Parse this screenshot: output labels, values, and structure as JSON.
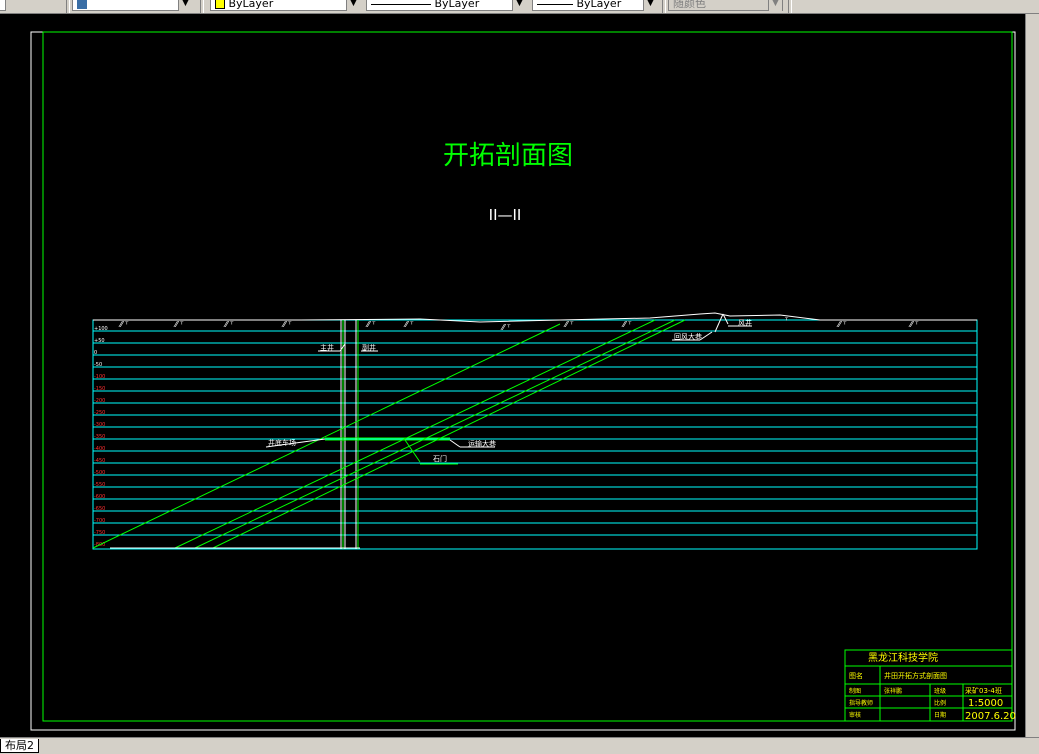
{
  "toolbar": {
    "layer_value": "",
    "color_value": "ByLayer",
    "linetype_value": "ByLayer",
    "lineweight_value": "ByLayer",
    "plotstyle_value": "随颜色"
  },
  "drawing": {
    "title": "开拓剖面图",
    "subtitle": "II—II",
    "labels": {
      "shaft_main": "主井",
      "shaft_aux": "副井",
      "ventilation_shaft": "风井",
      "return_roadway": "回风大巷",
      "haulage_roadway": "运输大巷",
      "shaft_bottom": "井底车场",
      "rock_gate": "石门"
    },
    "elevations": [
      "+100",
      "+50",
      "0",
      "-50",
      "-100",
      "-150",
      "-200",
      "-250",
      "-300",
      "-350",
      "-400",
      "-450",
      "-500",
      "-550",
      "-600",
      "-650",
      "-700",
      "-750",
      "-800"
    ]
  },
  "title_block": {
    "institution": "黑龙江科技学院",
    "row1_label": "图名",
    "row1_value": "井田开拓方式剖面图",
    "row2_label": "制图",
    "row2_value": "张祥鹏",
    "row2_label2": "班级",
    "row2_value2": "采矿03-4班",
    "row3_label": "指导教师",
    "row3_value": "",
    "row3_label2": "比例",
    "row3_value2": "1:5000",
    "row4_label": "审核",
    "row4_value": "",
    "row4_label2": "日期",
    "row4_value2": "2007.6.20"
  },
  "layout_tab": "布局2"
}
